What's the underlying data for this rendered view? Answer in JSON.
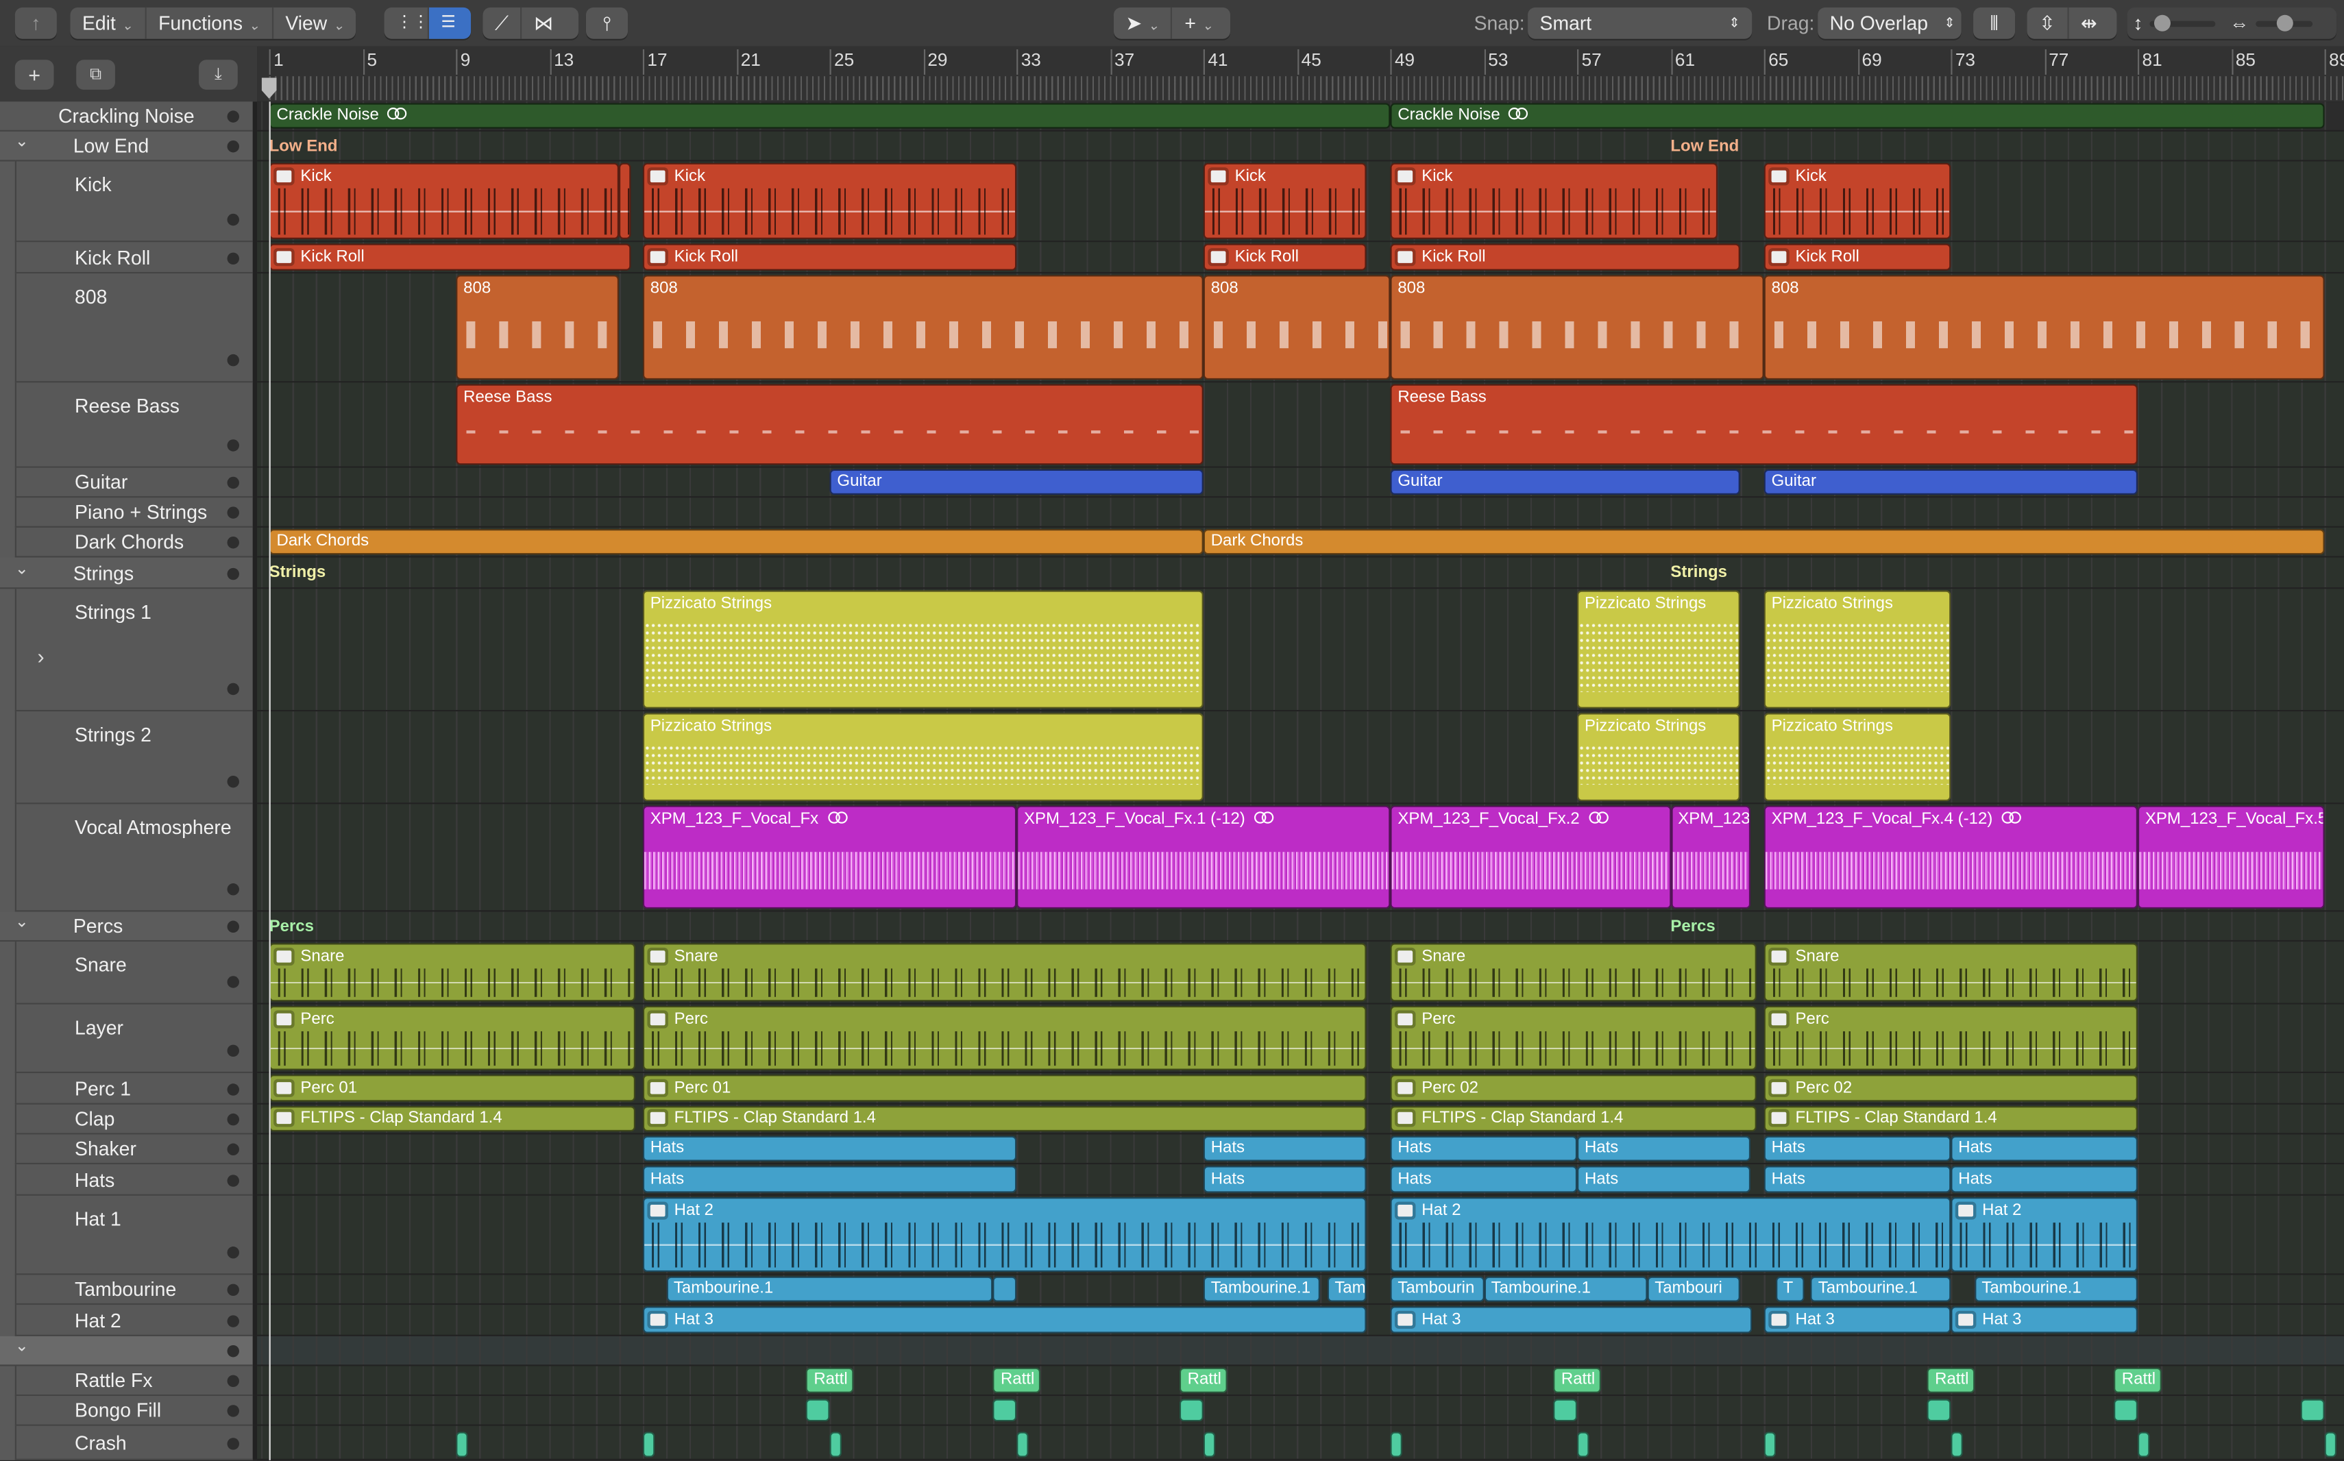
{
  "toolbar": {
    "back_icon": "catch-icon",
    "menus": [
      "Edit",
      "Functions",
      "View"
    ],
    "snap_label": "Snap:",
    "snap_value": "Smart",
    "drag_label": "Drag:",
    "drag_value": "No Overlap",
    "vertical_zoom": 0.1,
    "horizontal_zoom": 0.55
  },
  "ruler": {
    "bars": [
      1,
      5,
      9,
      13,
      17,
      21,
      25,
      29,
      33,
      37,
      41,
      45,
      49,
      53,
      57,
      61,
      65,
      69,
      73,
      77,
      81,
      85,
      89
    ],
    "playhead_bar": 1
  },
  "colors": {
    "noise": "#2e5a2b",
    "kick": "#c4442a",
    "orange": "#c4622e",
    "guitar": "#3f5fcf",
    "chords": "#d48a2e",
    "strings": "#c9c947",
    "vocal": "#bd2cc6",
    "perc": "#8ea23a",
    "hats": "#43a1cb",
    "rattle": "#5fcf8c",
    "bongo": "#4fcca0"
  },
  "tracks": [
    {
      "name": "Crackling Noise",
      "kind": "track",
      "color": "noise",
      "regions": [
        {
          "name": "Crackle Noise",
          "start": 1,
          "end": 49,
          "loop": true
        },
        {
          "name": "Crackle Noise",
          "start": 49,
          "end": 89,
          "loop": true
        }
      ]
    },
    {
      "name": "Low End",
      "kind": "folder",
      "label_color": "#f3b08a",
      "regions": []
    },
    {
      "name": "Kick",
      "kind": "child",
      "color": "kick",
      "deco": "hits",
      "regions": [
        {
          "name": "Kick",
          "start": 1,
          "end": 16,
          "icon": "folder"
        },
        {
          "name": "",
          "start": 16,
          "end": 16.5
        },
        {
          "name": "Kick",
          "start": 17,
          "end": 33,
          "icon": "folder"
        },
        {
          "name": "Kick",
          "start": 41,
          "end": 48,
          "icon": "folder"
        },
        {
          "name": "Kick",
          "start": 49,
          "end": 63,
          "icon": "folder"
        },
        {
          "name": "Kick",
          "start": 65,
          "end": 73,
          "icon": "folder"
        }
      ]
    },
    {
      "name": "Kick Roll",
      "kind": "child",
      "color": "kick",
      "regions": [
        {
          "name": "Kick Roll",
          "start": 1,
          "end": 16.5,
          "icon": "folder"
        },
        {
          "name": "Kick Roll",
          "start": 17,
          "end": 33,
          "icon": "folder"
        },
        {
          "name": "Kick Roll",
          "start": 41,
          "end": 48,
          "icon": "folder"
        },
        {
          "name": "Kick Roll",
          "start": 49,
          "end": 64,
          "icon": "folder"
        },
        {
          "name": "Kick Roll",
          "start": 65,
          "end": 73,
          "icon": "folder"
        }
      ]
    },
    {
      "name": "808",
      "kind": "child",
      "color": "orange",
      "deco": "notes",
      "regions": [
        {
          "name": "808",
          "start": 9,
          "end": 16
        },
        {
          "name": "808",
          "start": 17,
          "end": 41
        },
        {
          "name": "808",
          "start": 41,
          "end": 49
        },
        {
          "name": "808",
          "start": 49,
          "end": 65
        },
        {
          "name": "808",
          "start": 65,
          "end": 89
        }
      ]
    },
    {
      "name": "Reese Bass",
      "kind": "child",
      "color": "kick",
      "deco": "notes",
      "regions": [
        {
          "name": "Reese Bass",
          "start": 9,
          "end": 41
        },
        {
          "name": "Reese Bass",
          "start": 49,
          "end": 81
        }
      ]
    },
    {
      "name": "Guitar",
      "kind": "child",
      "color": "guitar",
      "regions": [
        {
          "name": "Guitar",
          "start": 25,
          "end": 41
        },
        {
          "name": "Guitar",
          "start": 49,
          "end": 64
        },
        {
          "name": "Guitar",
          "start": 65,
          "end": 81
        }
      ]
    },
    {
      "name": "Piano + Strings",
      "kind": "child",
      "regions": []
    },
    {
      "name": "Dark Chords",
      "kind": "child",
      "color": "chords",
      "regions": [
        {
          "name": "Dark Chords",
          "start": 1,
          "end": 41
        },
        {
          "name": "Dark Chords",
          "start": 41,
          "end": 89
        }
      ]
    },
    {
      "name": "Strings",
      "kind": "folder",
      "label_color": "#f0f0a8",
      "regions": []
    },
    {
      "name": "Strings 1",
      "kind": "child",
      "expander": true,
      "color": "strings",
      "deco": "dots",
      "regions": [
        {
          "name": "Pizzicato Strings",
          "start": 17,
          "end": 41
        },
        {
          "name": "Pizzicato Strings",
          "start": 57,
          "end": 64
        },
        {
          "name": "Pizzicato Strings",
          "start": 65,
          "end": 73
        }
      ]
    },
    {
      "name": "Strings 2",
      "kind": "child",
      "color": "strings",
      "deco": "dots",
      "regions": [
        {
          "name": "Pizzicato Strings",
          "start": 17,
          "end": 41
        },
        {
          "name": "Pizzicato Strings",
          "start": 57,
          "end": 64
        },
        {
          "name": "Pizzicato Strings",
          "start": 65,
          "end": 73
        }
      ]
    },
    {
      "name": "Vocal Atmosphere",
      "kind": "child",
      "color": "vocal",
      "deco": "wave",
      "regions": [
        {
          "name": "XPM_123_F_Vocal_Fx",
          "start": 17,
          "end": 33,
          "loop": true
        },
        {
          "name": "XPM_123_F_Vocal_Fx.1 (-12)",
          "start": 33,
          "end": 49,
          "loop": true
        },
        {
          "name": "XPM_123_F_Vocal_Fx.2",
          "start": 49,
          "end": 61,
          "loop": true
        },
        {
          "name": "XPM_123",
          "start": 61,
          "end": 64.4
        },
        {
          "name": "XPM_123_F_Vocal_Fx.4 (-12)",
          "start": 65,
          "end": 81,
          "loop": true
        },
        {
          "name": "XPM_123_F_Vocal_Fx.5",
          "start": 81,
          "end": 89
        }
      ]
    },
    {
      "name": "Percs",
      "kind": "folder",
      "label_color": "#a8f0a8",
      "regions": []
    },
    {
      "name": "Snare",
      "kind": "child",
      "color": "perc",
      "deco": "hits",
      "regions": [
        {
          "name": "Snare",
          "start": 1,
          "end": 16.7,
          "icon": "folder"
        },
        {
          "name": "Snare",
          "start": 17,
          "end": 48,
          "icon": "folder"
        },
        {
          "name": "Snare",
          "start": 49,
          "end": 64.7,
          "icon": "folder"
        },
        {
          "name": "Snare",
          "start": 65,
          "end": 81,
          "icon": "folder"
        }
      ]
    },
    {
      "name": "Layer",
      "kind": "child",
      "color": "perc",
      "deco": "hits",
      "regions": [
        {
          "name": "Perc",
          "start": 1,
          "end": 16.7,
          "icon": "folder"
        },
        {
          "name": "Perc",
          "start": 17,
          "end": 48,
          "icon": "folder"
        },
        {
          "name": "Perc",
          "start": 49,
          "end": 64.7,
          "icon": "folder"
        },
        {
          "name": "Perc",
          "start": 65,
          "end": 81,
          "icon": "folder"
        }
      ]
    },
    {
      "name": "Perc 1",
      "kind": "child",
      "color": "perc",
      "regions": [
        {
          "name": "Perc 01",
          "start": 1,
          "end": 16.7,
          "icon": "folder"
        },
        {
          "name": "Perc 01",
          "start": 17,
          "end": 48,
          "icon": "folder"
        },
        {
          "name": "Perc 02",
          "start": 49,
          "end": 64.7,
          "icon": "folder"
        },
        {
          "name": "Perc 02",
          "start": 65,
          "end": 81,
          "icon": "folder"
        }
      ]
    },
    {
      "name": "Clap",
      "kind": "child",
      "color": "perc",
      "regions": [
        {
          "name": "FLTIPS - Clap Standard 1.4",
          "start": 1,
          "end": 16.7,
          "icon": "folder"
        },
        {
          "name": "FLTIPS - Clap Standard 1.4",
          "start": 17,
          "end": 48,
          "icon": "folder"
        },
        {
          "name": "FLTIPS - Clap Standard 1.4",
          "start": 49,
          "end": 64.7,
          "icon": "folder"
        },
        {
          "name": "FLTIPS - Clap Standard 1.4",
          "start": 65,
          "end": 81,
          "icon": "folder"
        }
      ]
    },
    {
      "name": "Shaker",
      "kind": "child",
      "color": "hats",
      "regions": [
        {
          "name": "Hats",
          "start": 17,
          "end": 33
        },
        {
          "name": "Hats",
          "start": 41,
          "end": 48
        },
        {
          "name": "Hats",
          "start": 49,
          "end": 57
        },
        {
          "name": "Hats",
          "start": 57,
          "end": 64.4
        },
        {
          "name": "Hats",
          "start": 65,
          "end": 73
        },
        {
          "name": "Hats",
          "start": 73,
          "end": 81
        }
      ]
    },
    {
      "name": "Hats",
      "kind": "child",
      "color": "hats",
      "regions": [
        {
          "name": "Hats",
          "start": 17,
          "end": 33
        },
        {
          "name": "Hats",
          "start": 41,
          "end": 48
        },
        {
          "name": "Hats",
          "start": 49,
          "end": 57
        },
        {
          "name": "Hats",
          "start": 57,
          "end": 64.4
        },
        {
          "name": "Hats",
          "start": 65,
          "end": 73
        },
        {
          "name": "Hats",
          "start": 73,
          "end": 81
        }
      ]
    },
    {
      "name": "Hat 1",
      "kind": "child",
      "color": "hats",
      "deco": "hits",
      "regions": [
        {
          "name": "Hat 2",
          "start": 17,
          "end": 48,
          "icon": "folder"
        },
        {
          "name": "Hat 2",
          "start": 49,
          "end": 73,
          "icon": "folder"
        },
        {
          "name": "Hat 2",
          "start": 73,
          "end": 81,
          "icon": "folder"
        }
      ]
    },
    {
      "name": "Tambourine",
      "kind": "child",
      "color": "hats",
      "regions": [
        {
          "name": "Tambourine.1",
          "start": 18,
          "end": 32
        },
        {
          "name": "",
          "start": 32,
          "end": 33
        },
        {
          "name": "Tambourine.1",
          "start": 41,
          "end": 46
        },
        {
          "name": "Tam",
          "start": 46.3,
          "end": 48
        },
        {
          "name": "Tambourin",
          "start": 49,
          "end": 53
        },
        {
          "name": "Tambourine.1",
          "start": 53,
          "end": 60
        },
        {
          "name": "Tambouri",
          "start": 60,
          "end": 64
        },
        {
          "name": "T",
          "start": 65.5,
          "end": 66.7
        },
        {
          "name": "Tambourine.1",
          "start": 67,
          "end": 73
        },
        {
          "name": "Tambourine.1",
          "start": 74,
          "end": 81
        }
      ]
    },
    {
      "name": "Hat 2",
      "kind": "child",
      "color": "hats",
      "regions": [
        {
          "name": "Hat 3",
          "start": 17,
          "end": 48,
          "icon": "folder"
        },
        {
          "name": "Hat 3",
          "start": 49,
          "end": 64.5,
          "icon": "folder"
        },
        {
          "name": "Hat 3",
          "start": 65,
          "end": 73,
          "icon": "folder"
        },
        {
          "name": "Hat 3",
          "start": 73,
          "end": 81,
          "icon": "folder"
        }
      ]
    },
    {
      "name": "",
      "kind": "folder",
      "regions": []
    },
    {
      "name": "Rattle Fx",
      "kind": "child",
      "color": "rattle",
      "regions": [
        {
          "name": "Rattl",
          "start": 24,
          "end": 26
        },
        {
          "name": "Rattl",
          "start": 32,
          "end": 34
        },
        {
          "name": "Rattl",
          "start": 40,
          "end": 42
        },
        {
          "name": "Rattl",
          "start": 56,
          "end": 58
        },
        {
          "name": "Rattl",
          "start": 72,
          "end": 74
        },
        {
          "name": "Rattl",
          "start": 80,
          "end": 82
        }
      ]
    },
    {
      "name": "Bongo Fill",
      "kind": "child",
      "color": "bongo",
      "regions": [
        {
          "name": "",
          "start": 24,
          "end": 25
        },
        {
          "name": "",
          "start": 32,
          "end": 33
        },
        {
          "name": "",
          "start": 40,
          "end": 41
        },
        {
          "name": "",
          "start": 56,
          "end": 57
        },
        {
          "name": "",
          "start": 72,
          "end": 73
        },
        {
          "name": "",
          "start": 80,
          "end": 81
        },
        {
          "name": "",
          "start": 88,
          "end": 89
        }
      ]
    },
    {
      "name": "Crash",
      "kind": "child",
      "color": "bongo",
      "regions": [
        {
          "name": "",
          "start": 9,
          "end": 9.5
        },
        {
          "name": "",
          "start": 17,
          "end": 17.5
        },
        {
          "name": "",
          "start": 25,
          "end": 25.5
        },
        {
          "name": "",
          "start": 33,
          "end": 33.5
        },
        {
          "name": "",
          "start": 41,
          "end": 41.5
        },
        {
          "name": "",
          "start": 49,
          "end": 49.5
        },
        {
          "name": "",
          "start": 57,
          "end": 57.5
        },
        {
          "name": "",
          "start": 65,
          "end": 65.5
        },
        {
          "name": "",
          "start": 73,
          "end": 73.5
        },
        {
          "name": "",
          "start": 81,
          "end": 81.5
        },
        {
          "name": "",
          "start": 89,
          "end": 89.5
        }
      ]
    }
  ],
  "folder_label_bars": [
    1,
    61
  ]
}
